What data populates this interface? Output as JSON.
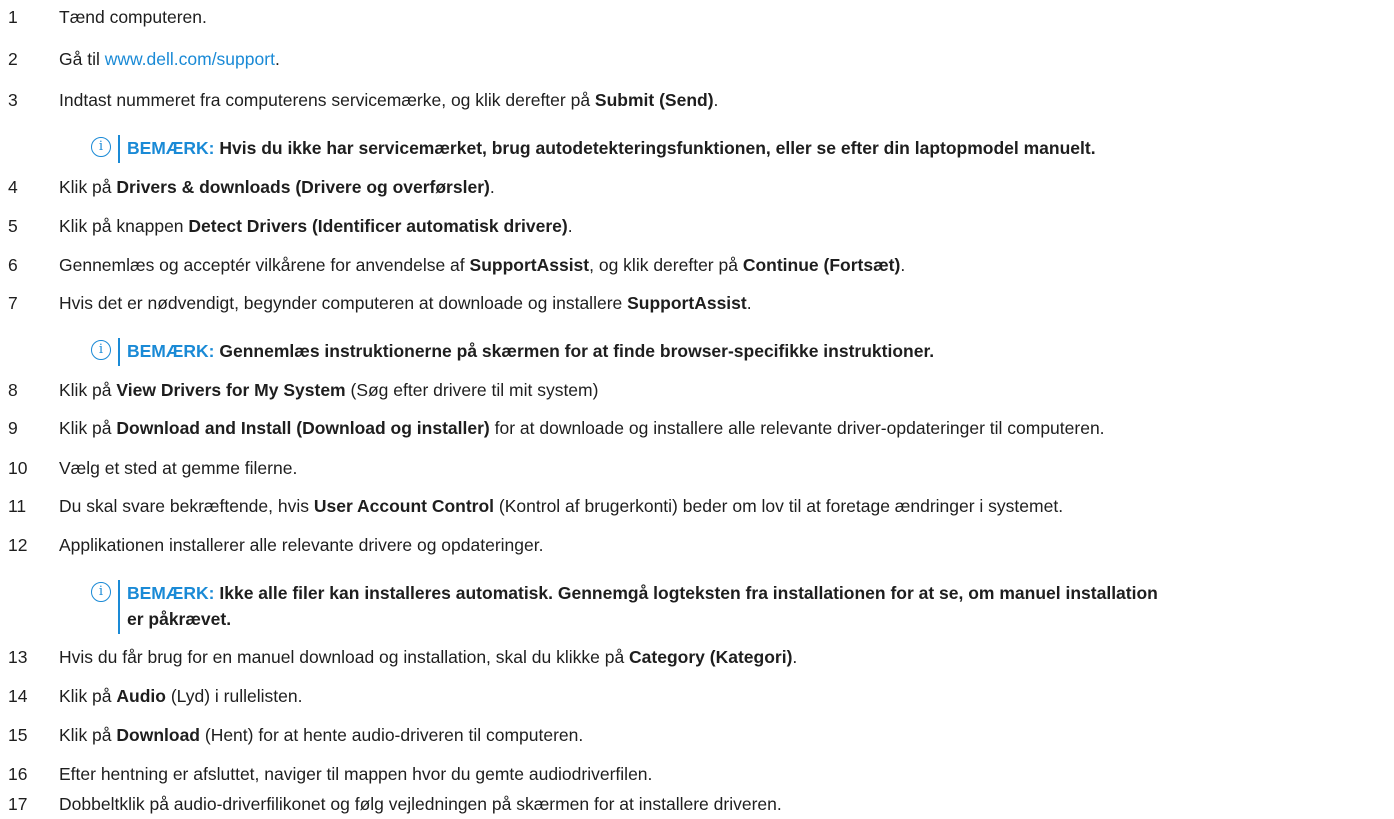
{
  "steps": [
    {
      "num": "1",
      "parts": [
        {
          "t": "Tænd computeren."
        }
      ]
    },
    {
      "num": "2",
      "parts": [
        {
          "t": "Gå til "
        },
        {
          "t": "www.dell.com/support",
          "link": true
        },
        {
          "t": "."
        }
      ]
    },
    {
      "num": "3",
      "parts": [
        {
          "t": "Indtast nummeret fra computerens servicemærke, og klik derefter på "
        },
        {
          "t": "Submit (Send)",
          "b": true
        },
        {
          "t": "."
        }
      ]
    },
    {
      "num": "4",
      "parts": [
        {
          "t": "Klik på "
        },
        {
          "t": "Drivers & downloads (Drivere og overførsler)",
          "b": true
        },
        {
          "t": "."
        }
      ]
    },
    {
      "num": "5",
      "parts": [
        {
          "t": "Klik på knappen "
        },
        {
          "t": "Detect Drivers (Identificer automatisk drivere)",
          "b": true
        },
        {
          "t": "."
        }
      ]
    },
    {
      "num": "6",
      "parts": [
        {
          "t": "Gennemlæs og acceptér vilkårene for anvendelse af "
        },
        {
          "t": "SupportAssist",
          "b": true
        },
        {
          "t": ", og klik derefter på "
        },
        {
          "t": "Continue (Fortsæt)",
          "b": true
        },
        {
          "t": "."
        }
      ]
    },
    {
      "num": "7",
      "parts": [
        {
          "t": "Hvis det er nødvendigt, begynder computeren at downloade og installere "
        },
        {
          "t": "SupportAssist",
          "b": true
        },
        {
          "t": "."
        }
      ]
    },
    {
      "num": "8",
      "parts": [
        {
          "t": "Klik på "
        },
        {
          "t": "View Drivers for My System",
          "b": true
        },
        {
          "t": " (Søg efter drivere til mit system)"
        }
      ]
    },
    {
      "num": "9",
      "parts": [
        {
          "t": "Klik på "
        },
        {
          "t": "Download and Install (Download og installer)",
          "b": true
        },
        {
          "t": " for at downloade og installere alle relevante driver-opdateringer til computeren."
        }
      ]
    },
    {
      "num": "10",
      "parts": [
        {
          "t": "Vælg et sted at gemme filerne."
        }
      ]
    },
    {
      "num": "11",
      "parts": [
        {
          "t": "Du skal svare bekræftende, hvis "
        },
        {
          "t": "User Account Control",
          "b": true
        },
        {
          "t": " (Kontrol af brugerkonti) beder om lov til at foretage ændringer i systemet."
        }
      ]
    },
    {
      "num": "12",
      "parts": [
        {
          "t": "Applikationen installerer alle relevante drivere og opdateringer."
        }
      ]
    },
    {
      "num": "13",
      "parts": [
        {
          "t": "Hvis du får brug for en manuel download og installation, skal du klikke på "
        },
        {
          "t": "Category (Kategori)",
          "b": true
        },
        {
          "t": "."
        }
      ]
    },
    {
      "num": "14",
      "parts": [
        {
          "t": "Klik på "
        },
        {
          "t": "Audio",
          "b": true
        },
        {
          "t": " (Lyd) i rullelisten."
        }
      ]
    },
    {
      "num": "15",
      "parts": [
        {
          "t": "Klik på "
        },
        {
          "t": "Download",
          "b": true
        },
        {
          "t": " (Hent) for at hente audio-driveren til computeren."
        }
      ]
    },
    {
      "num": "16",
      "parts": [
        {
          "t": "Efter hentning er afsluttet, naviger til mappen hvor du gemte audiodriverfilen."
        }
      ]
    },
    {
      "num": "17",
      "parts": [
        {
          "t": "Dobbeltklik på audio-driverfilikonet og følg vejledningen på skærmen for at installere driveren."
        }
      ]
    }
  ],
  "notes": [
    {
      "label": "BEMÆRK:",
      "lines": [
        "Hvis du ikke har servicemærket, brug autodetekteringsfunktionen, eller se efter din laptopmodel manuelt."
      ]
    },
    {
      "label": "BEMÆRK:",
      "lines": [
        "Gennemlæs instruktionerne på skærmen for at finde browser-specifikke instruktioner."
      ]
    },
    {
      "label": "BEMÆRK:",
      "lines": [
        "Ikke alle filer kan installeres automatisk. Gennemgå logteksten fra installationen for at se, om manuel installation",
        "er påkrævet."
      ]
    }
  ],
  "note_icon": "info-icon",
  "colors": {
    "accent": "#1a8ad6",
    "text": "#1e1e1e"
  }
}
